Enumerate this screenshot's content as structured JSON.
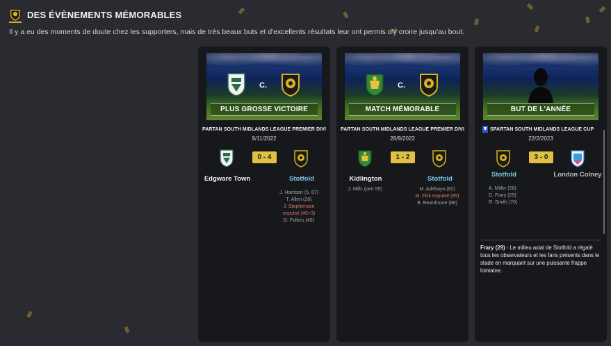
{
  "header": {
    "title": "DES ÉVÈNEMENTS MÉMORABLES",
    "intro": "Il y a eu des moments de doute chez les supporters, mais de très beaux buts et d'excellents résultats leur ont permis d'y croire jusqu'au bout."
  },
  "colors": {
    "accent": "#d9b21f",
    "score_bg": "#e0c043",
    "highlight_team": "#7ec8e6",
    "red_card": "#e07a70",
    "card_bg": "#17181c",
    "page_bg": "#2a2b30"
  },
  "cards": [
    {
      "banner_label": "PLUS GROSSE VICTOIRE",
      "vs": "C.",
      "competition": "PARTAN SOUTH MIDLANDS LEAGUE PREMIER DIVI",
      "date": "9/11/2022",
      "score": "0 - 4",
      "home_team": "Edgware Town",
      "away_team": "Stotfold",
      "home_scorers": [],
      "away_scorers": [
        "J. Harrison (5, 67)",
        "T. Allen (28)",
        "J. Stephenson",
        "expulsé (45+3)",
        "D. Folkes (49)"
      ],
      "icons": {
        "home": "edgware-crest-icon",
        "away": "stotfold-crest-icon"
      }
    },
    {
      "banner_label": "MATCH MÉMORABLE",
      "vs": "C.",
      "competition": "PARTAN SOUTH MIDLANDS LEAGUE PREMIER DIVI",
      "date": "28/9/2022",
      "score": "1 - 2",
      "home_team": "Kidlington",
      "away_team": "Stotfold",
      "home_scorers": [
        "J. Mills (pen 59)"
      ],
      "away_scorers": [
        "M. Adebayo (82)",
        "M. Fisk expulsé (85)",
        "B. Beardmore (88)"
      ],
      "icons": {
        "home": "kidlington-crest-icon",
        "away": "stotfold-crest-icon"
      }
    },
    {
      "banner_label": "BUT DE L'ANNÉE",
      "competition": "SPARTAN SOUTH MIDLANDS LEAGUE CUP",
      "date": "22/2/2023",
      "score": "3 - 0",
      "home_team": "Stotfold",
      "away_team": "London Colney",
      "home_scorers": [
        "A. Miller (26)",
        "D. Frary (29)",
        "R. Smith (70)"
      ],
      "away_scorers": [],
      "description_player": "Frary (29)",
      "description_text": " - Le milieu axial de Stotfold a régalé tous les observateurs et les fans présents dans le stade en marquant sur une puissante frappe lointaine.",
      "icons": {
        "home": "stotfold-crest-icon",
        "away": "london-colney-crest-icon",
        "cup": "cup-icon",
        "player": "player-silhouette-icon"
      }
    }
  ]
}
